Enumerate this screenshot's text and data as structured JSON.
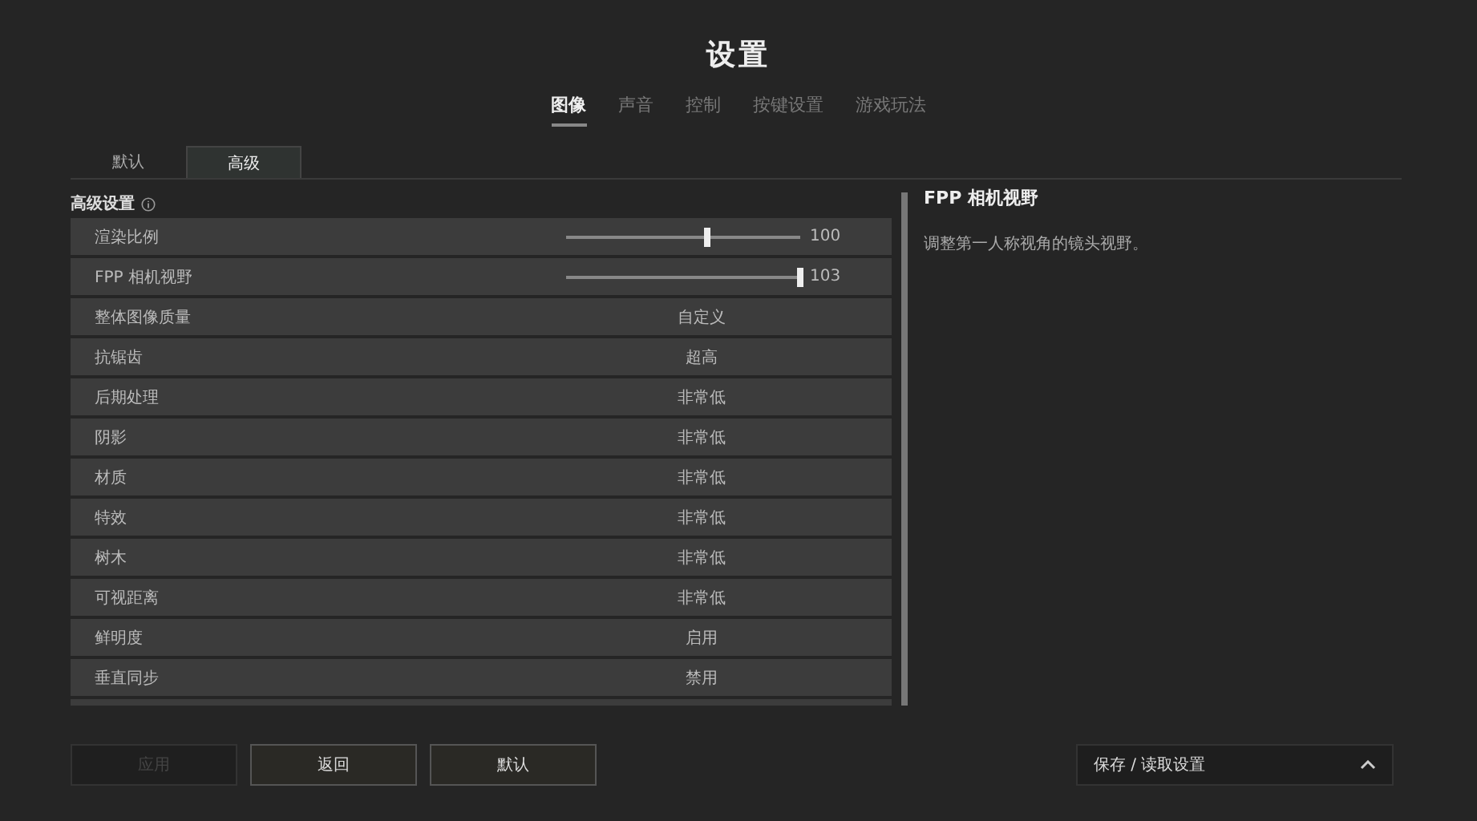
{
  "title": "设置",
  "main_tabs": [
    {
      "label": "图像",
      "selected": true
    },
    {
      "label": "声音",
      "selected": false
    },
    {
      "label": "控制",
      "selected": false
    },
    {
      "label": "按键设置",
      "selected": false
    },
    {
      "label": "游戏玩法",
      "selected": false
    }
  ],
  "sub_tabs": [
    {
      "label": "默认",
      "selected": false
    },
    {
      "label": "高级",
      "selected": true
    }
  ],
  "section_title": "高级设置",
  "rows": [
    {
      "kind": "slider",
      "label": "渲染比例",
      "level": 0.6,
      "value": "100"
    },
    {
      "kind": "slider",
      "label": "FPP 相机视野",
      "level": 1.0,
      "value": "103"
    },
    {
      "kind": "option",
      "label": "整体图像质量",
      "value": "自定义"
    },
    {
      "kind": "option",
      "label": "抗锯齿",
      "value": "超高"
    },
    {
      "kind": "option",
      "label": "后期处理",
      "value": "非常低"
    },
    {
      "kind": "option",
      "label": "阴影",
      "value": "非常低"
    },
    {
      "kind": "option",
      "label": "材质",
      "value": "非常低"
    },
    {
      "kind": "option",
      "label": "特效",
      "value": "非常低"
    },
    {
      "kind": "option",
      "label": "树木",
      "value": "非常低"
    },
    {
      "kind": "option",
      "label": "可视距离",
      "value": "非常低"
    },
    {
      "kind": "option",
      "label": "鲜明度",
      "value": "启用"
    },
    {
      "kind": "option",
      "label": "垂直同步",
      "value": "禁用"
    }
  ],
  "detail": {
    "title": "FPP 相机视野",
    "description": "调整第一人称视角的镜头视野。"
  },
  "buttons": [
    {
      "label": "应用",
      "disabled": true
    },
    {
      "label": "返回",
      "disabled": false
    },
    {
      "label": "默认",
      "disabled": false
    }
  ],
  "save_load": {
    "label": "保存 / 读取设置",
    "expanded": false
  }
}
